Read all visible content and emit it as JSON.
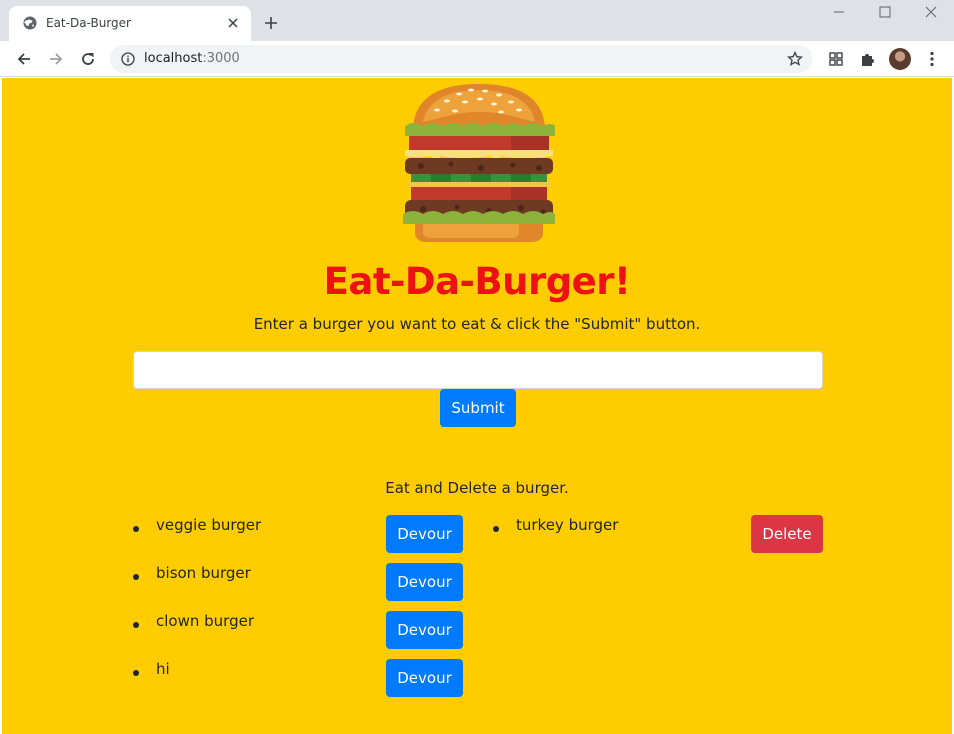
{
  "browser": {
    "tab_title": "Eat-Da-Burger",
    "url_host": "localhost",
    "url_port": ":3000"
  },
  "page": {
    "title": "Eat-Da-Burger!",
    "instructions": "Enter a burger you want to eat & click the \"Submit\" button.",
    "input_value": "",
    "submit_label": "Submit",
    "section_label": "Eat and Delete a burger.",
    "uneaten": [
      {
        "name": "veggie burger",
        "action": "Devour"
      },
      {
        "name": "bison burger",
        "action": "Devour"
      },
      {
        "name": "clown burger",
        "action": "Devour"
      },
      {
        "name": "hi",
        "action": "Devour"
      }
    ],
    "eaten": [
      {
        "name": "turkey burger",
        "action": "Delete"
      }
    ]
  },
  "colors": {
    "background": "#ffcc00",
    "title": "#ee1111",
    "primary": "#007bff",
    "danger": "#dc3545"
  }
}
